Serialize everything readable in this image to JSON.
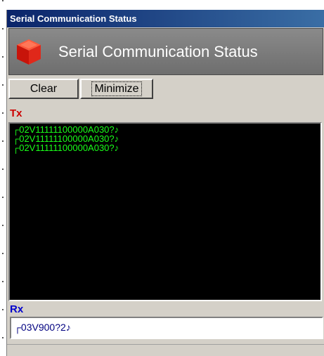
{
  "window": {
    "title": "Serial Communication Status"
  },
  "header": {
    "title": "Serial Communication Status",
    "icon": "red-cube-icon"
  },
  "toolbar": {
    "clear_label": "Clear",
    "minimize_label": "Minimize"
  },
  "tx": {
    "label": "Tx",
    "lines": [
      "┌02V11111100000A030?♪",
      "┌02V11111100000A030?♪",
      "┌02V11111100000A030?♪"
    ]
  },
  "rx": {
    "label": "Rx",
    "value": "┌03V900?2♪"
  },
  "colors": {
    "titlebar": "#0a246a",
    "tx_label": "#cc0000",
    "rx_label": "#0000cc",
    "tx_text": "#19ff19",
    "tx_background": "#000000"
  }
}
